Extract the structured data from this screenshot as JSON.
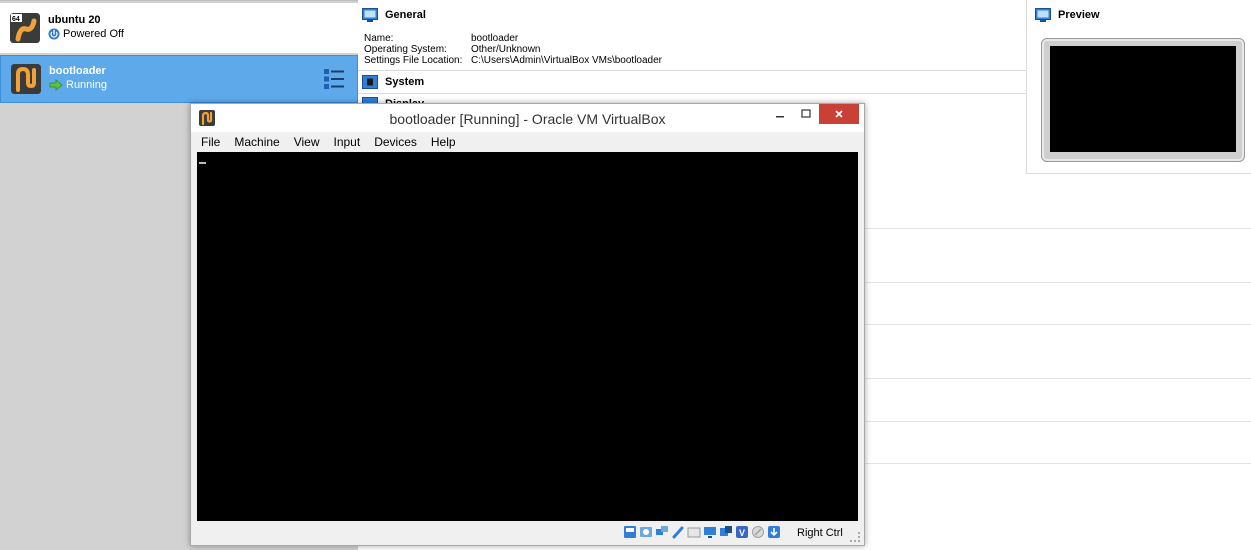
{
  "vm_list": [
    {
      "name": "ubuntu 20",
      "status": "Powered Off",
      "os_icon": "ubuntu-64-icon",
      "status_icon": "power-icon"
    },
    {
      "name": "bootloader",
      "status": "Running",
      "os_icon": "other-os-icon",
      "status_icon": "running-arrow-icon",
      "selected": true
    }
  ],
  "details": {
    "general": {
      "title": "General",
      "rows": [
        {
          "label": "Name:",
          "value": "bootloader"
        },
        {
          "label": "Operating System:",
          "value": "Other/Unknown"
        },
        {
          "label": "Settings File Location:",
          "value": "C:\\Users\\Admin\\VirtualBox VMs\\bootloader"
        }
      ]
    },
    "system": {
      "title": "System"
    },
    "display": {
      "title": "Display"
    }
  },
  "preview": {
    "title": "Preview"
  },
  "vm_window": {
    "title": "bootloader [Running] - Oracle VM VirtualBox",
    "menu": [
      "File",
      "Machine",
      "View",
      "Input",
      "Devices",
      "Help"
    ],
    "host_key": "Right Ctrl",
    "status_icons": [
      "hard-disk-icon",
      "optical-drive-icon",
      "network-icon",
      "usb-icon",
      "shared-folders-icon",
      "display-icon",
      "recording-icon",
      "vt-x-icon",
      "mouse-integration-icon",
      "host-key-arrow-icon"
    ]
  },
  "colors": {
    "selected_row": "#5ea9ea",
    "close_button": "#c94036",
    "screen": "#000000"
  }
}
